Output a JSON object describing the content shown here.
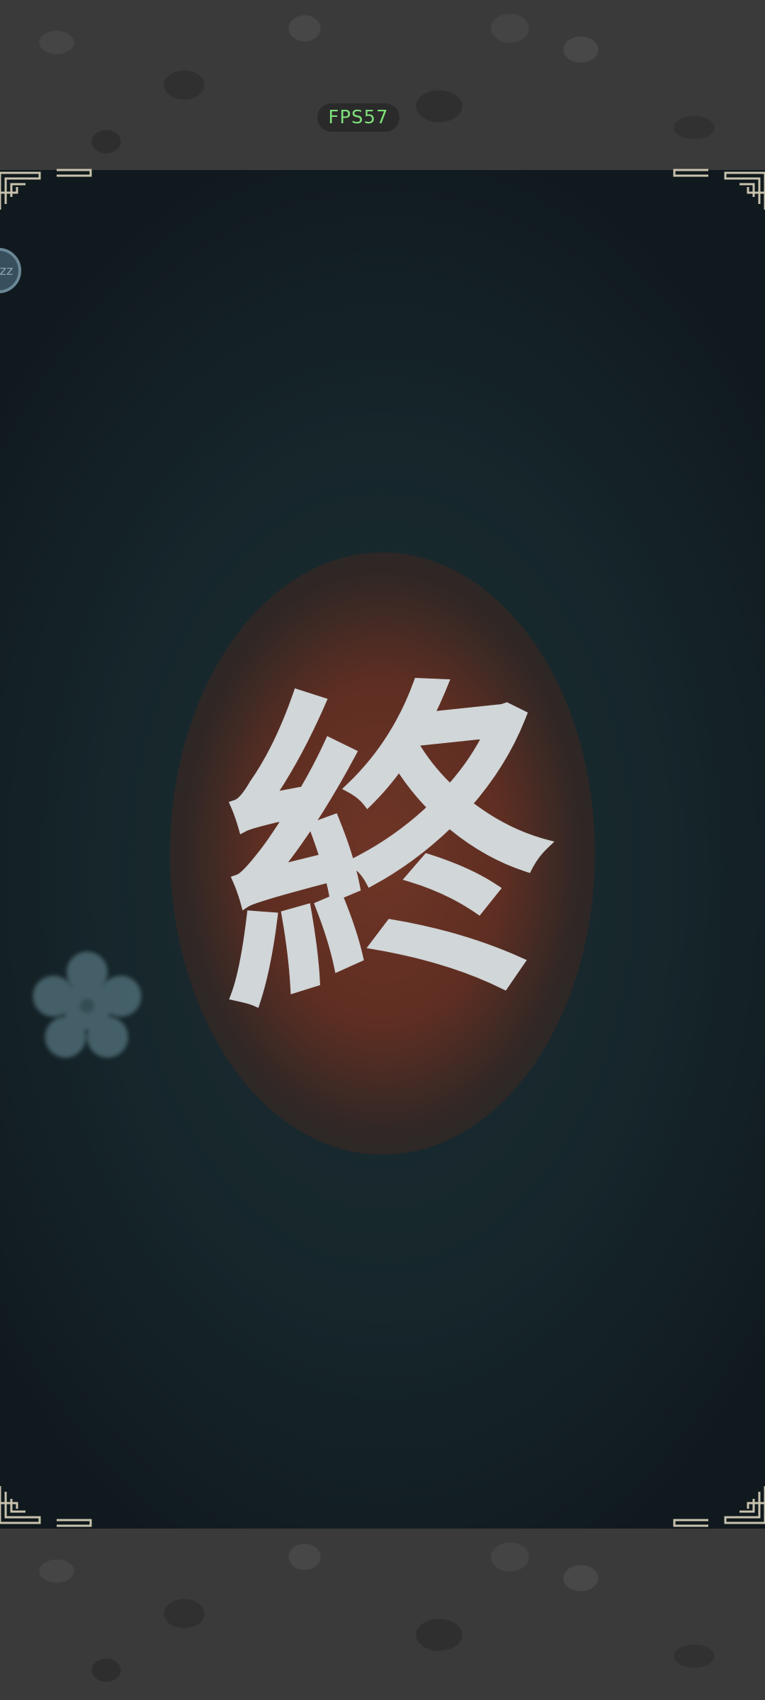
{
  "hud": {
    "fps": "FPS57"
  },
  "screen": {
    "glyph": "終"
  },
  "icons": {
    "sleep": "zz-sleep-icon",
    "flower": "plum-blossom-icon",
    "corner": "lattice-corner-ornament"
  },
  "colors": {
    "fps_text": "#7fe07a",
    "panel_bg": "#16262b",
    "glow": "#6e3526",
    "glyph": "#d1d6d8",
    "ornament": "#c9c2ad",
    "flower": "#4d6a73"
  }
}
